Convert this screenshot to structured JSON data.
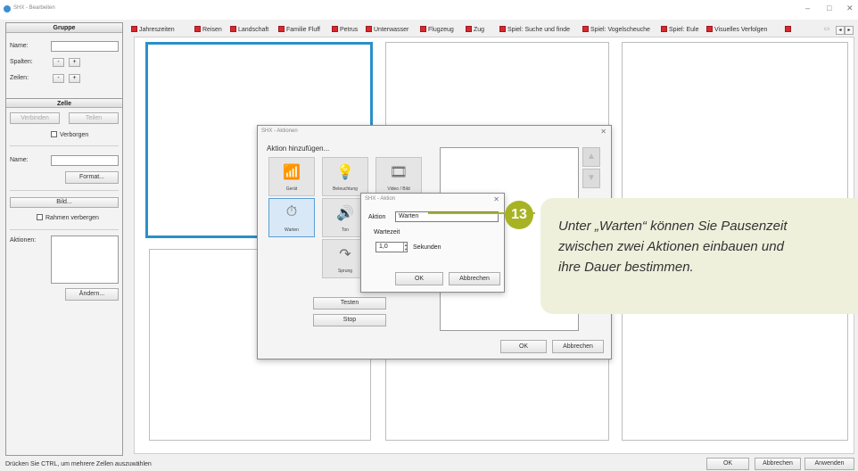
{
  "window": {
    "title": "SHX - Bearbeiten",
    "minimize": "–",
    "maximize": "□",
    "close": "✕"
  },
  "left": {
    "gruppe": {
      "header": "Gruppe",
      "name_label": "Name:",
      "spalten_label": "Spalten:",
      "zeilen_label": "Zeilen:",
      "minus": "-",
      "plus": "+"
    },
    "zelle": {
      "header": "Zelle",
      "verbinden": "Verbinden",
      "teilen": "Teilen",
      "verborgen": "Verborgen",
      "name_label": "Name:",
      "format_button": "Format...",
      "bild_button": "Bild...",
      "rahmen_verbergen": "Rahmen verbergen",
      "aktionen_label": "Aktionen:",
      "aendern_button": "Ändern..."
    }
  },
  "tabs": [
    "Jahreszeiten",
    "Reisen",
    "Landschaft",
    "Familie Fluff",
    "Petrus",
    "Unterwasser",
    "Flugzeug",
    "Zug",
    "Spiel: Suche und finde",
    "Spiel: Vogelscheuche",
    "Spiel: Eule",
    "Visuelles Verfolgen"
  ],
  "aktionen_dialog": {
    "title": "SHX - Aktionen",
    "close": "✕",
    "heading": "Aktion hinzufügen...",
    "tiles": [
      "Gerät",
      "Beleuchtung",
      "Video / Bild",
      "Warten",
      "Ton",
      "Sprung"
    ],
    "up": "▲",
    "down": "▼",
    "testen": "Testen",
    "stop": "Stop",
    "ok": "OK",
    "abbrechen": "Abbrechen"
  },
  "aktion_dialog": {
    "title": "SHX - Aktion",
    "close": "✕",
    "aktion_label": "Aktion",
    "aktion_value": "Warten",
    "wartezeit_label": "Wartezeit",
    "wartezeit_value": "1,0",
    "unit": "Sekunden",
    "ok": "OK",
    "abbrechen": "Abbrechen"
  },
  "callout": {
    "number": "13",
    "line1": "Unter „Warten“ können Sie Pausenzeit",
    "line2": "zwischen zwei Aktionen einbauen und",
    "line3": "ihre Dauer bestimmen."
  },
  "status": {
    "hint": "Drücken Sie CTRL, um mehrere Zellen auszuwählen",
    "ok": "OK",
    "abbrechen": "Abbrechen",
    "anwenden": "Anwenden"
  },
  "colors": {
    "accent": "#2a8fc9",
    "callout": "#a8b324",
    "tab_close": "#d9282f"
  }
}
